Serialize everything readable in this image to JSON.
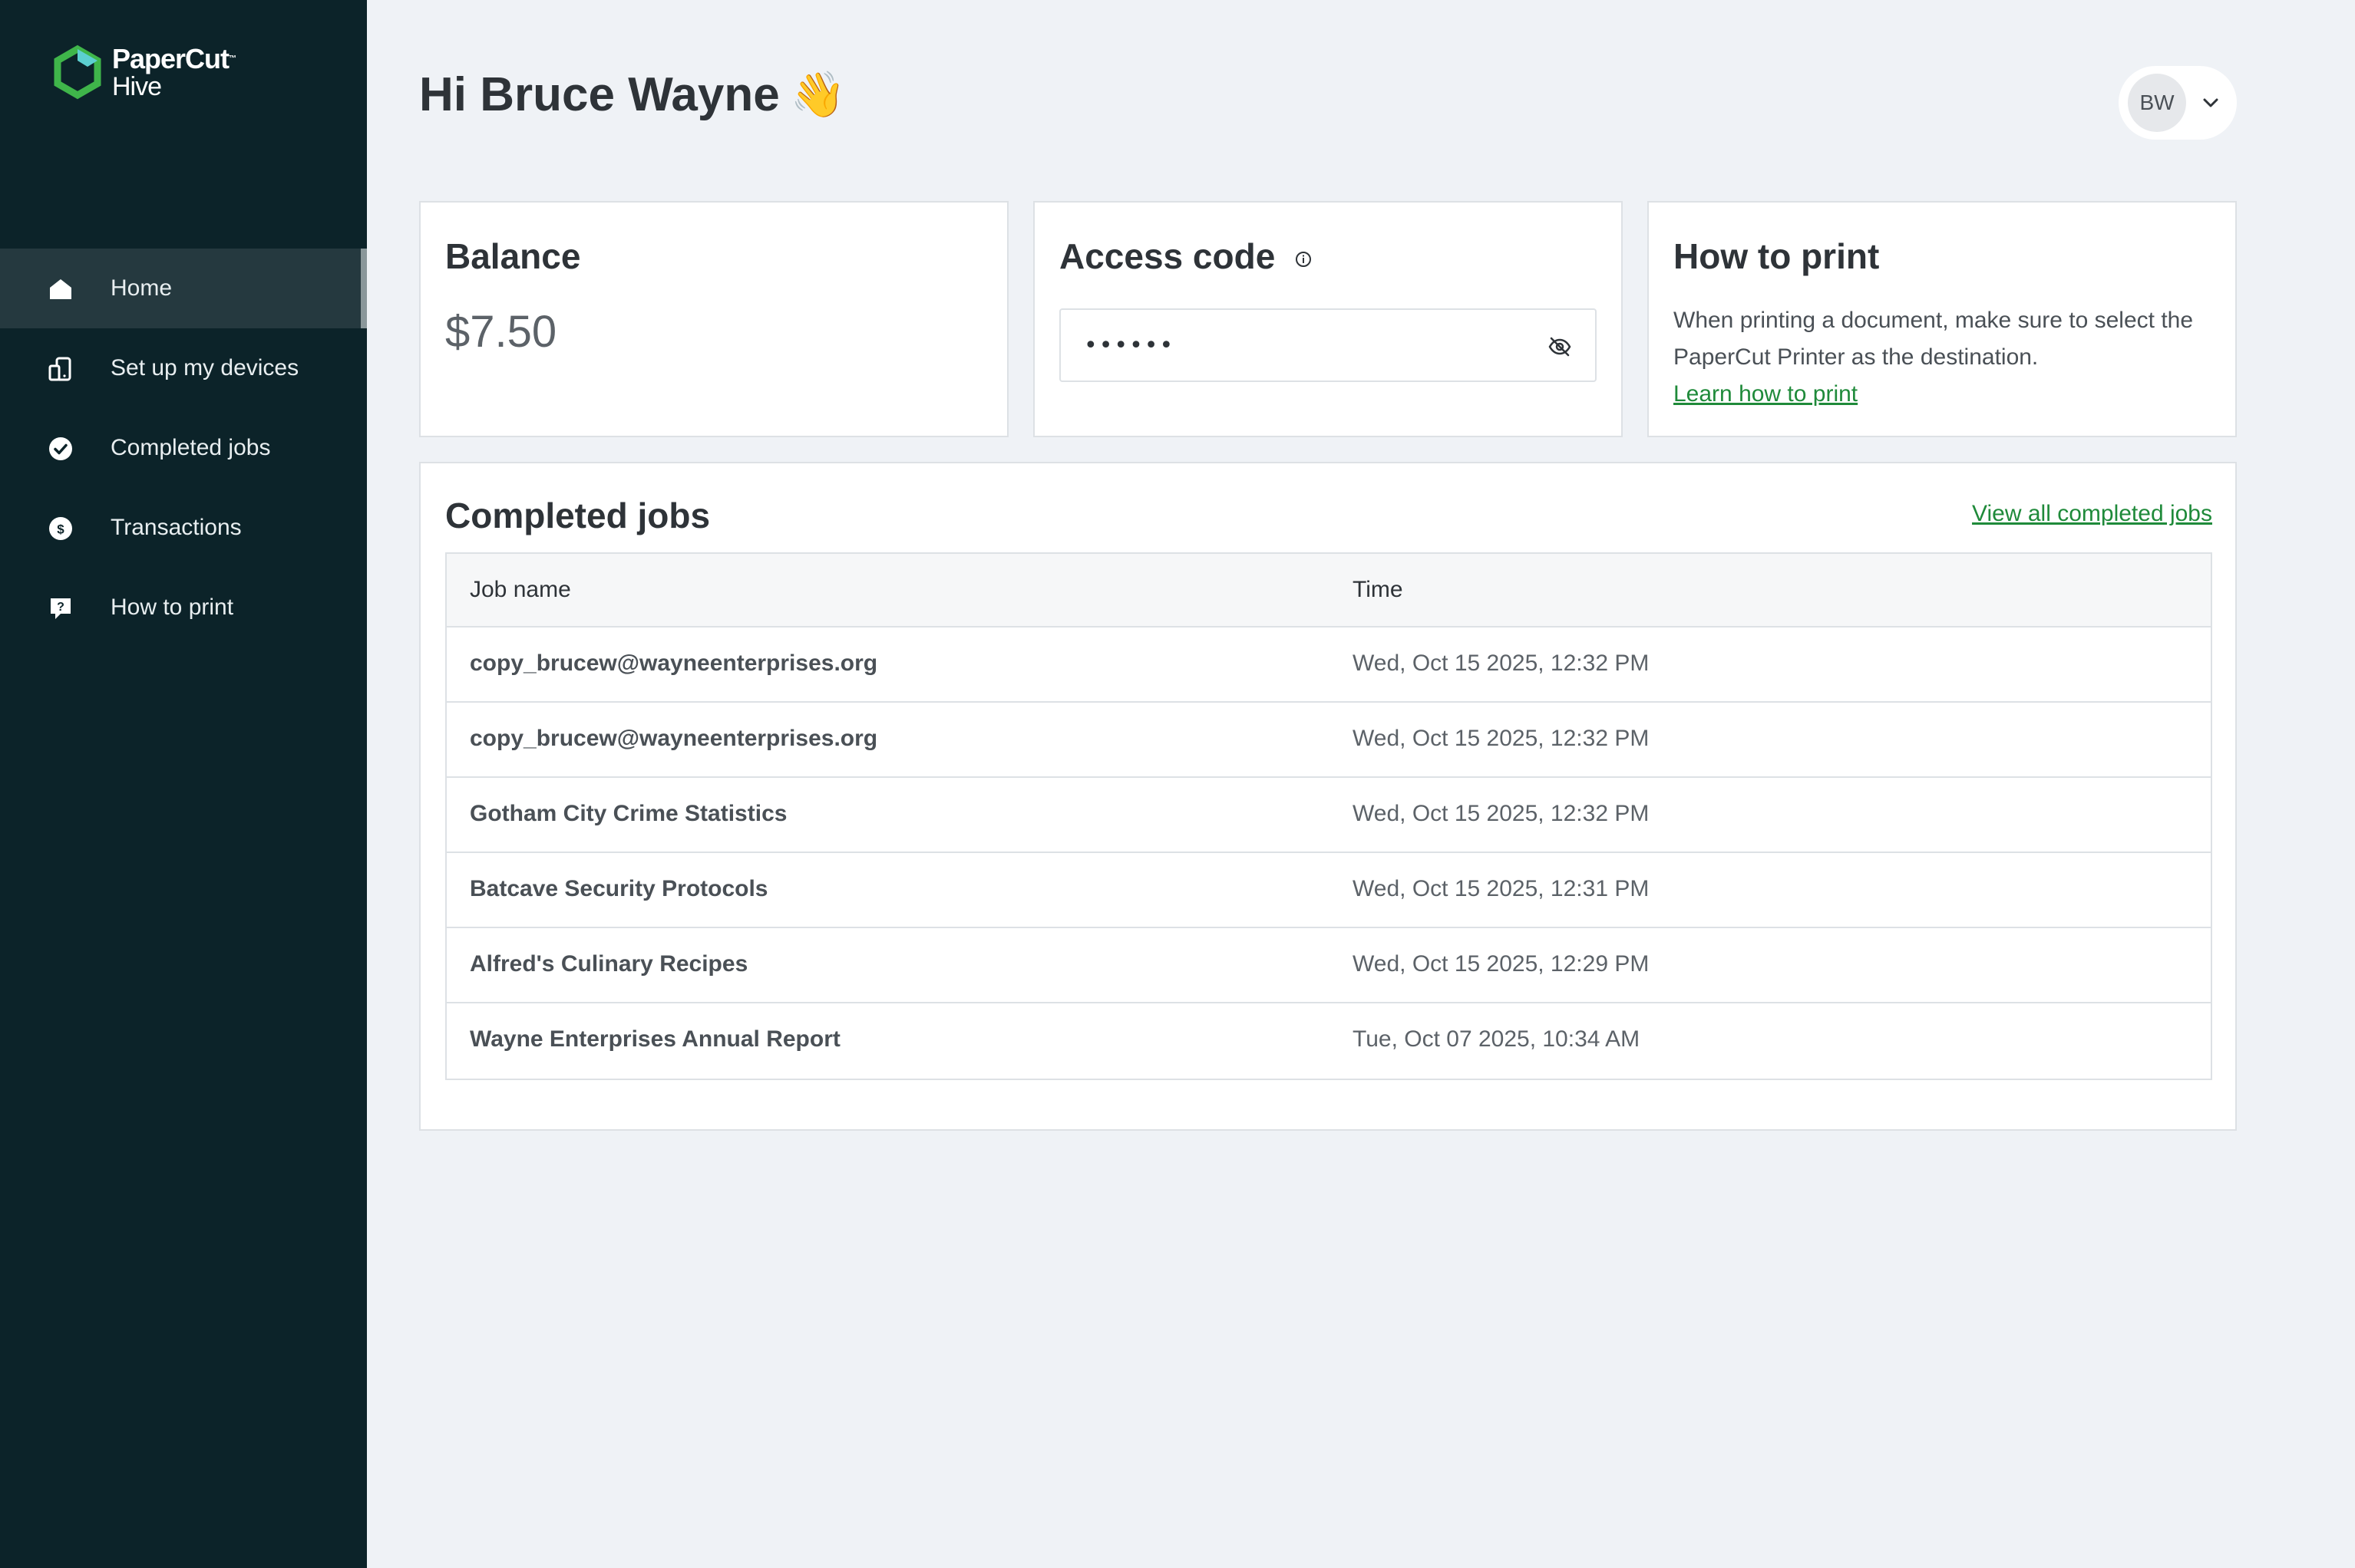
{
  "app": {
    "brand_line1": "PaperCut",
    "brand_line2": "Hive",
    "brand_mark": "™"
  },
  "sidebar": {
    "items": [
      {
        "label": "Home",
        "icon": "home-icon",
        "active": true
      },
      {
        "label": "Set up my devices",
        "icon": "devices-icon",
        "active": false
      },
      {
        "label": "Completed jobs",
        "icon": "check-circle-icon",
        "active": false
      },
      {
        "label": "Transactions",
        "icon": "dollar-circle-icon",
        "active": false
      },
      {
        "label": "How to print",
        "icon": "help-bubble-icon",
        "active": false
      }
    ]
  },
  "header": {
    "greeting": "Hi Bruce Wayne",
    "wave_emoji": "👋",
    "user_initials": "BW"
  },
  "balance": {
    "title": "Balance",
    "value": "$7.50"
  },
  "access_code": {
    "title": "Access code",
    "value": "••••••"
  },
  "how_to_print": {
    "title": "How to print",
    "text": "When printing a document, make sure to select the PaperCut Printer as the destination.",
    "link": "Learn how to print"
  },
  "completed_jobs": {
    "title": "Completed jobs",
    "view_all": "View all completed jobs",
    "columns": [
      "Job name",
      "Time"
    ],
    "rows": [
      {
        "name": "copy_brucew@wayneenterprises.org",
        "time": "Wed, Oct 15 2025, 12:32 PM"
      },
      {
        "name": "copy_brucew@wayneenterprises.org",
        "time": "Wed, Oct 15 2025, 12:32 PM"
      },
      {
        "name": "Gotham City Crime Statistics",
        "time": "Wed, Oct 15 2025, 12:32 PM"
      },
      {
        "name": "Batcave Security Protocols",
        "time": "Wed, Oct 15 2025, 12:31 PM"
      },
      {
        "name": "Alfred's Culinary Recipes",
        "time": "Wed, Oct 15 2025, 12:29 PM"
      },
      {
        "name": "Wayne Enterprises Annual Report",
        "time": "Tue, Oct 07 2025, 10:34 AM"
      }
    ]
  },
  "colors": {
    "sidebar_bg": "#0c2329",
    "page_bg": "#eff2f6",
    "link": "#1f8a3a",
    "brand_green": "#3fb54a",
    "brand_teal": "#5ccfd0"
  }
}
